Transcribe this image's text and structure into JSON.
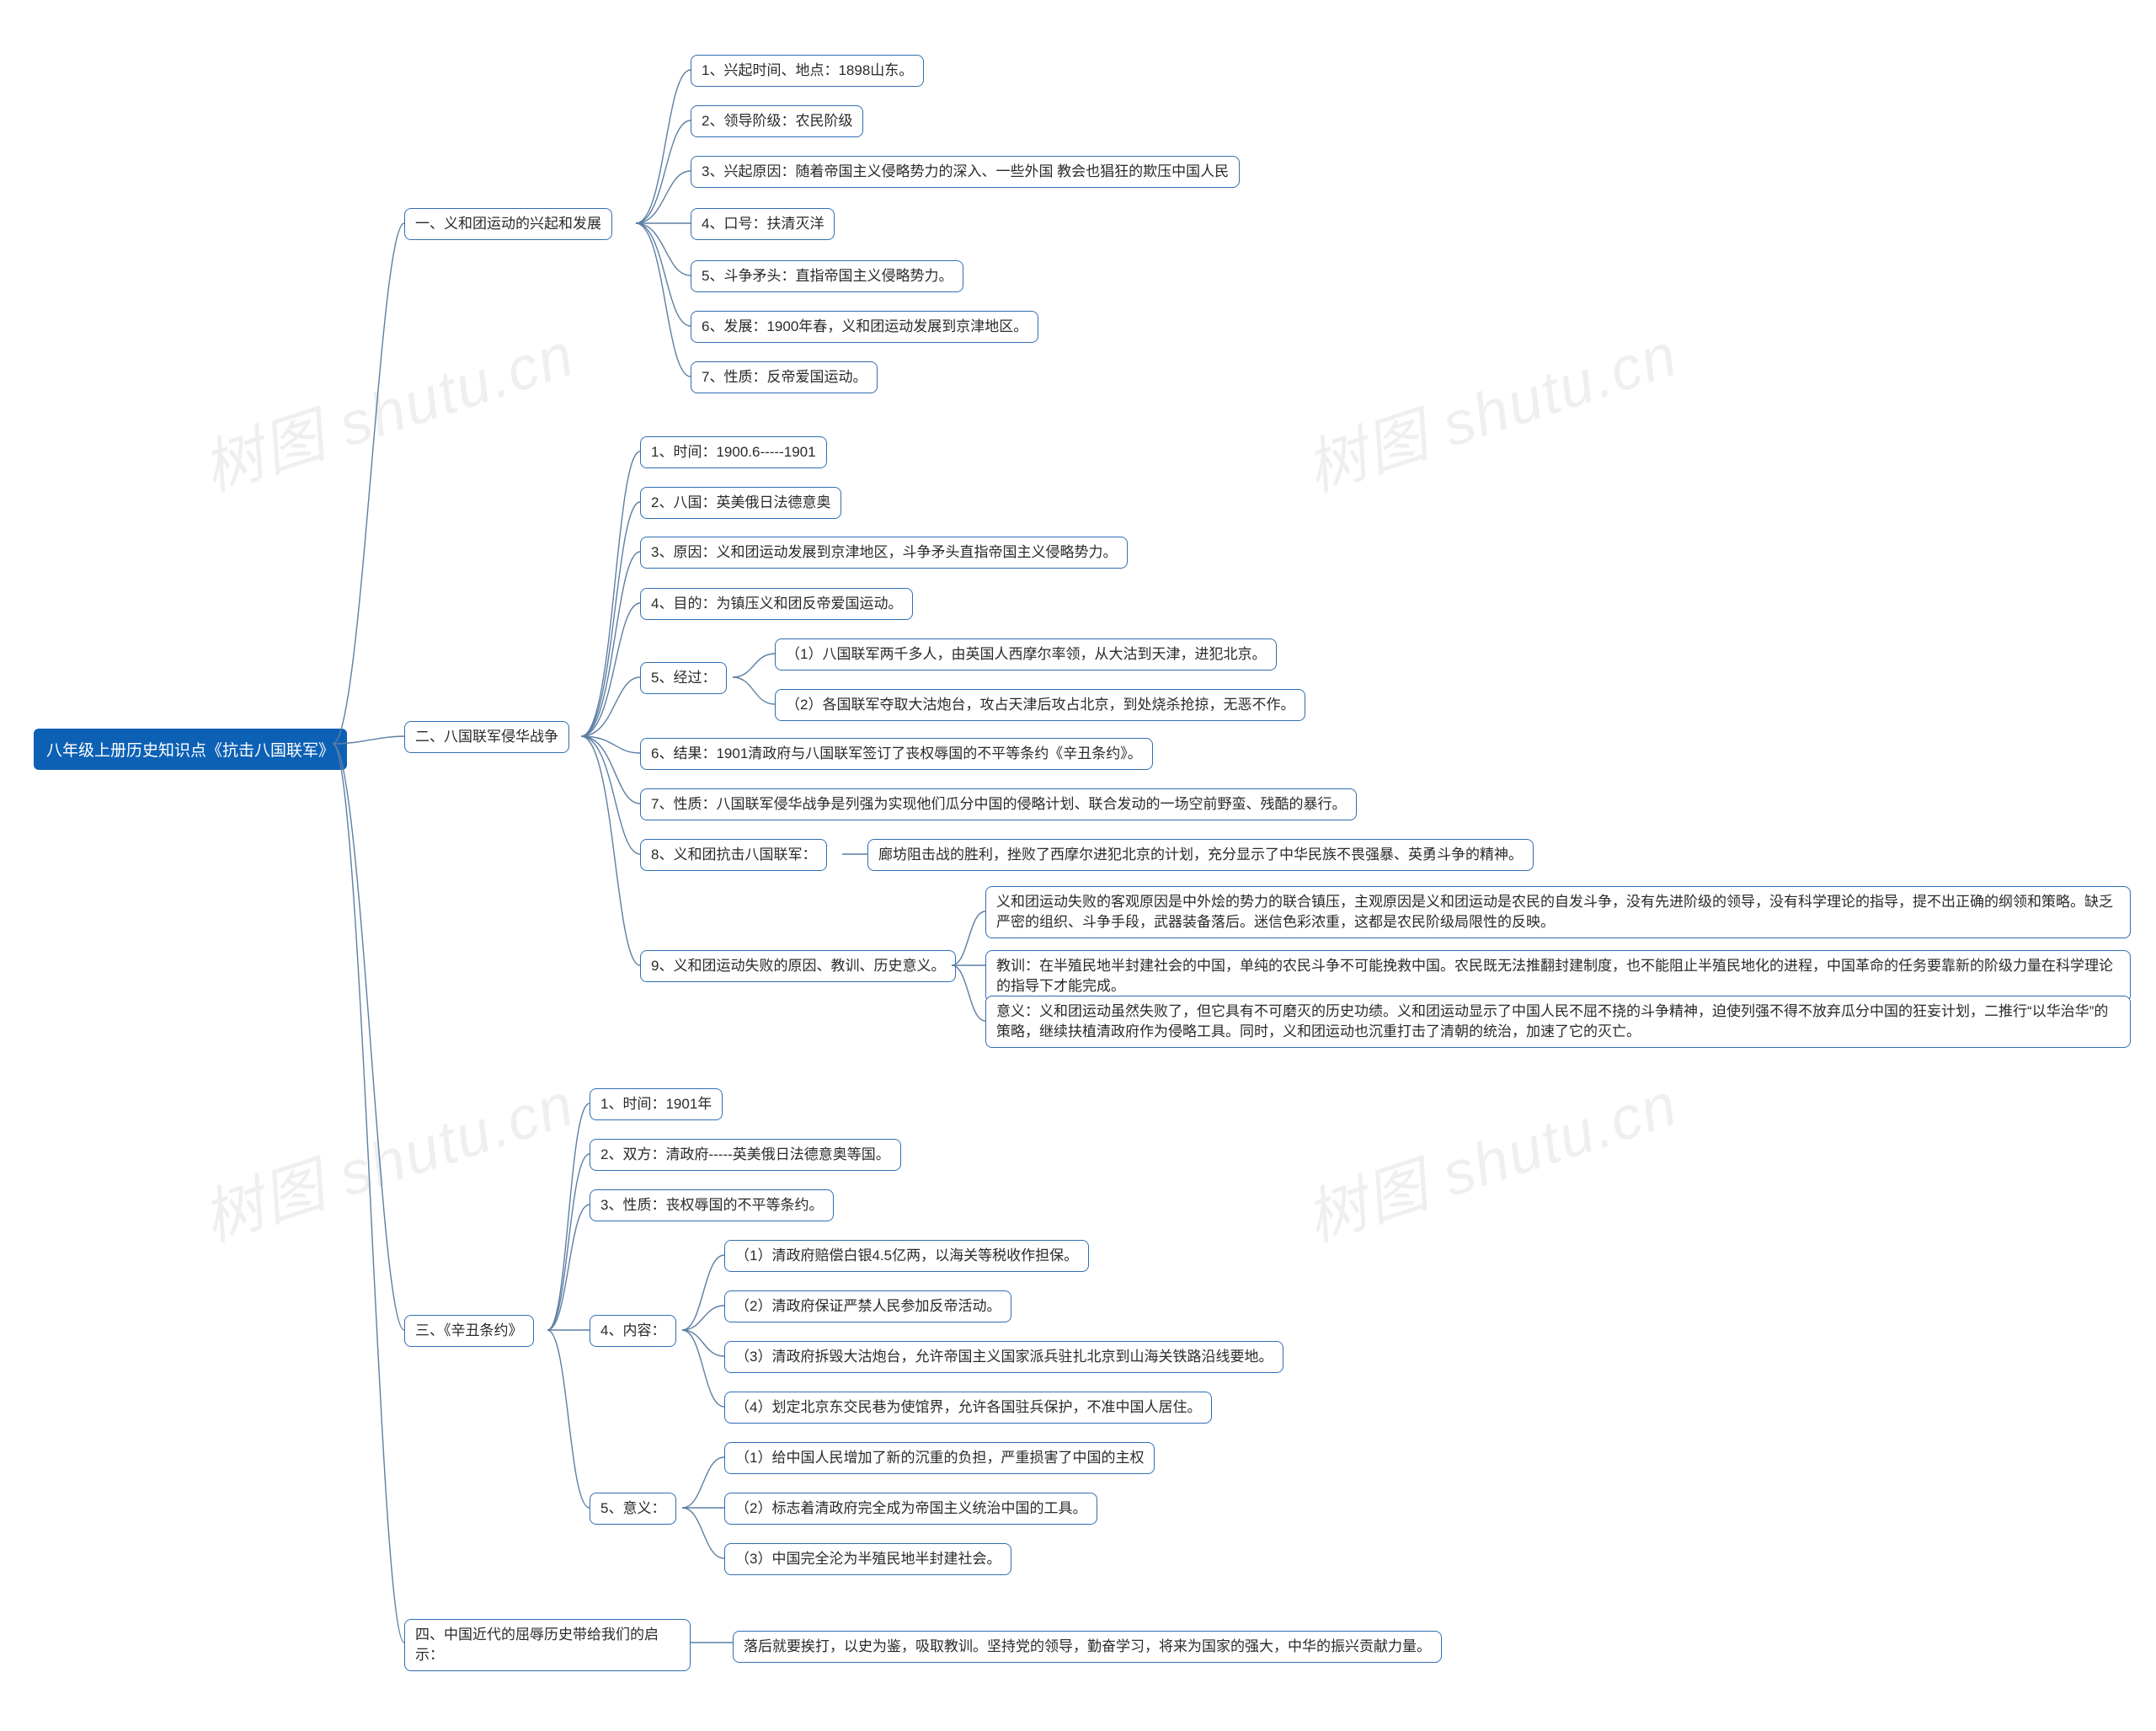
{
  "root": "八年级上册历史知识点《抗击八国联军》",
  "s1": {
    "title": "一、义和团运动的兴起和发展",
    "n1": "1、兴起时间、地点：1898山东。",
    "n2": "2、领导阶级：农民阶级",
    "n3": "3、兴起原因：随着帝国主义侵略势力的深入、一些外国 教会也猖狂的欺压中国人民",
    "n4": "4、口号：扶清灭洋",
    "n5": "5、斗争矛头：直指帝国主义侵略势力。",
    "n6": "6、发展：1900年春，义和团运动发展到京津地区。",
    "n7": "7、性质：反帝爱国运动。"
  },
  "s2": {
    "title": "二、八国联军侵华战争",
    "n1": "1、时间：1900.6-----1901",
    "n2": "2、八国：英美俄日法德意奥",
    "n3": "3、原因：义和团运动发展到京津地区，斗争矛头直指帝国主义侵略势力。",
    "n4": "4、目的：为镇压义和团反帝爱国运动。",
    "n5": {
      "label": "5、经过：",
      "c1": "（1）八国联军两千多人，由英国人西摩尔率领，从大沽到天津，进犯北京。",
      "c2": "（2）各国联军夺取大沽炮台，攻占天津后攻占北京，到处烧杀抢掠，无恶不作。"
    },
    "n6": "6、结果：1901清政府与八国联军签订了丧权辱国的不平等条约《辛丑条约》。",
    "n7": "7、性质：八国联军侵华战争是列强为实现他们瓜分中国的侵略计划、联合发动的一场空前野蛮、残酷的暴行。",
    "n8": {
      "label": "8、义和团抗击八国联军：",
      "c1": "廊坊阻击战的胜利，挫败了西摩尔进犯北京的计划，充分显示了中华民族不畏强暴、英勇斗争的精神。"
    },
    "n9": {
      "label": "9、义和团运动失败的原因、教训、历史意义。",
      "c1": "义和团运动失败的客观原因是中外烩的势力的联合镇压，主观原因是义和团运动是农民的自发斗争，没有先进阶级的领导，没有科学理论的指导，提不出正确的纲领和策略。缺乏严密的组织、斗争手段，武器装备落后。迷信色彩浓重，这都是农民阶级局限性的反映。",
      "c2": "教训：在半殖民地半封建社会的中国，单纯的农民斗争不可能挽救中国。农民既无法推翻封建制度，也不能阻止半殖民地化的进程，中国革命的任务要靠新的阶级力量在科学理论的指导下才能完成。",
      "c3": "意义：义和团运动虽然失败了，但它具有不可磨灭的历史功绩。义和团运动显示了中国人民不屈不挠的斗争精神，迫使列强不得不放弃瓜分中国的狂妄计划，二推行“以华治华”的策略，继续扶植清政府作为侵略工具。同时，义和团运动也沉重打击了清朝的统治，加速了它的灭亡。"
    }
  },
  "s3": {
    "title": "三、《辛丑条约》",
    "n1": "1、时间：1901年",
    "n2": "2、双方：清政府-----英美俄日法德意奥等国。",
    "n3": "3、性质：丧权辱国的不平等条约。",
    "n4": {
      "label": "4、内容：",
      "c1": "（1）清政府赔偿白银4.5亿两，以海关等税收作担保。",
      "c2": "（2）清政府保证严禁人民参加反帝活动。",
      "c3": "（3）清政府拆毁大沽炮台，允许帝国主义国家派兵驻扎北京到山海关铁路沿线要地。",
      "c4": "（4）划定北京东交民巷为使馆界，允许各国驻兵保护，不准中国人居住。"
    },
    "n5": {
      "label": "5、意义：",
      "c1": "（1）给中国人民增加了新的沉重的负担，严重损害了中国的主权",
      "c2": "（2）标志着清政府完全成为帝国主义统治中国的工具。",
      "c3": "（3）中国完全沦为半殖民地半封建社会。"
    }
  },
  "s4": {
    "title": "四、中国近代的屈辱历史带给我们的启示：",
    "c1": "落后就要挨打，以史为鉴，吸取教训。坚持党的领导，勤奋学习，将来为国家的强大，中华的振兴贡献力量。"
  },
  "watermark": "树图 shutu.cn"
}
